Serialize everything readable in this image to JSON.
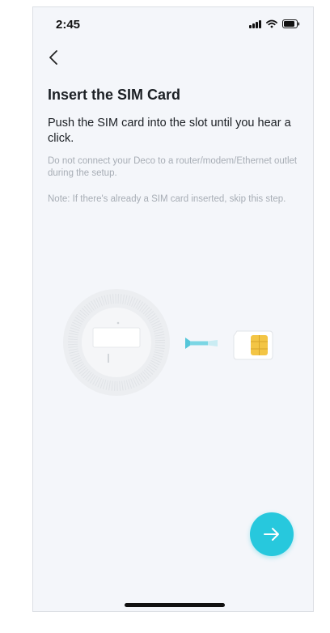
{
  "status_bar": {
    "time": "2:45",
    "icons": [
      "signal-icon",
      "wifi-icon",
      "battery-icon"
    ]
  },
  "nav": {
    "back_icon": "chevron-left-icon"
  },
  "content": {
    "title": "Insert the SIM Card",
    "instruction": "Push the SIM card into the slot until you hear a click.",
    "notes": [
      "Do not connect your Deco to a router/modem/Ethernet outlet during the setup.",
      "Note: If there's already a SIM card inserted, skip this step."
    ]
  },
  "illustration": {
    "icons": [
      "deco-device-icon",
      "arrow-left-icon",
      "sim-card-icon"
    ]
  },
  "actions": {
    "next_icon": "arrow-right-icon"
  },
  "colors": {
    "accent": "#27c8dd",
    "background": "#f4f6fa",
    "text_primary": "#1b1f24",
    "text_secondary": "#a7adb5",
    "sim_chip": "#f3c545"
  }
}
